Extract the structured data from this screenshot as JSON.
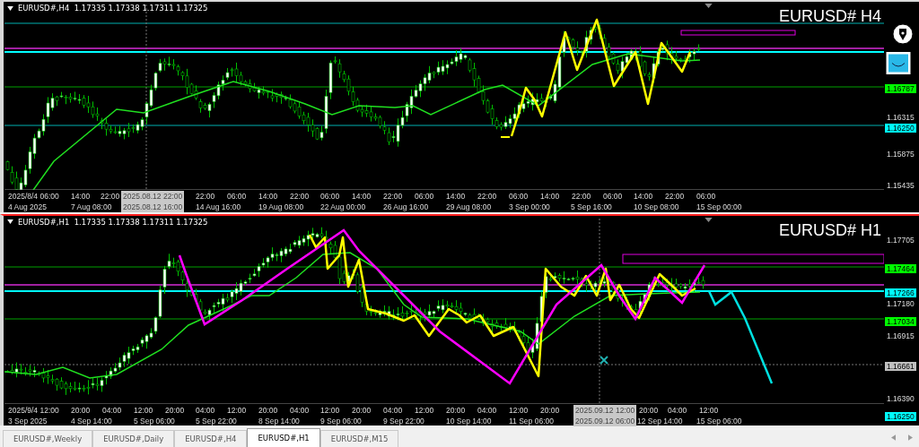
{
  "panes": [
    {
      "header": "EURUSD#,H4  1.17335 1.17338 1.17311 1.17325",
      "title": "EURUSD# H4",
      "active": false,
      "price_labels": [
        {
          "text": "1.16787",
          "kind": "badge",
          "color": "#00ff00"
        },
        {
          "text": "1.16315",
          "kind": "plain"
        },
        {
          "text": "1.16250",
          "kind": "badge",
          "color": "#00ffff"
        },
        {
          "text": "1.15875",
          "kind": "plain"
        },
        {
          "text": "1.15435",
          "kind": "plain"
        }
      ],
      "time_row_1": [
        {
          "text": "2025/8/4 06:00",
          "highlight": false
        },
        {
          "text": "14:00",
          "highlight": false
        },
        {
          "text": "22:00",
          "highlight": false
        },
        {
          "text": "2025.08.12 22:00",
          "highlight": true
        },
        {
          "text": "22:00",
          "highlight": false
        },
        {
          "text": "06:00",
          "highlight": false
        },
        {
          "text": "14:00",
          "highlight": false
        },
        {
          "text": "22:00",
          "highlight": false
        },
        {
          "text": "06:00",
          "highlight": false
        },
        {
          "text": "14:00",
          "highlight": false
        },
        {
          "text": "22:00",
          "highlight": false
        },
        {
          "text": "06:00",
          "highlight": false
        },
        {
          "text": "14:00",
          "highlight": false
        },
        {
          "text": "22:00",
          "highlight": false
        },
        {
          "text": "06:00",
          "highlight": false
        },
        {
          "text": "14:00",
          "highlight": false
        },
        {
          "text": "22:00",
          "highlight": false
        },
        {
          "text": "06:00",
          "highlight": false
        },
        {
          "text": "14:00",
          "highlight": false
        },
        {
          "text": "22:00",
          "highlight": false
        },
        {
          "text": "06:00",
          "highlight": false
        }
      ],
      "time_row_2": [
        {
          "text": "4 Aug 2025",
          "highlight": false
        },
        {
          "text": "7 Aug 08:00",
          "highlight": false
        },
        {
          "text": "2025.08.12 16:00",
          "highlight": true
        },
        {
          "text": "14 Aug 16:00",
          "highlight": false
        },
        {
          "text": "19 Aug 08:00",
          "highlight": false
        },
        {
          "text": "22 Aug 00:00",
          "highlight": false
        },
        {
          "text": "26 Aug 16:00",
          "highlight": false
        },
        {
          "text": "29 Aug 08:00",
          "highlight": false
        },
        {
          "text": "3 Sep 00:00",
          "highlight": false
        },
        {
          "text": "5 Sep 16:00",
          "highlight": false
        },
        {
          "text": "10 Sep 08:00",
          "highlight": false
        },
        {
          "text": "15 Sep 00:00",
          "highlight": false
        }
      ]
    },
    {
      "header": "EURUSD#,H1  1.17335 1.17338 1.17311 1.17325",
      "title": "EURUSD# H1",
      "active": true,
      "price_labels": [
        {
          "text": "1.17705",
          "kind": "plain"
        },
        {
          "text": "1.17464",
          "kind": "badge",
          "color": "#00ff00"
        },
        {
          "text": "1.17266",
          "kind": "badge",
          "color": "#00ffff"
        },
        {
          "text": "1.17180",
          "kind": "plain"
        },
        {
          "text": "1.17034",
          "kind": "badge",
          "color": "#00ff00"
        },
        {
          "text": "1.16915",
          "kind": "plain"
        },
        {
          "text": "1.16661",
          "kind": "badge",
          "color": "#c0c0c0"
        },
        {
          "text": "1.16390",
          "kind": "plain"
        },
        {
          "text": "1.16250",
          "kind": "badge",
          "color": "#00ffff"
        }
      ],
      "time_row_1": [
        {
          "text": "2025/9/4 12:00",
          "highlight": false
        },
        {
          "text": "20:00",
          "highlight": false
        },
        {
          "text": "04:00",
          "highlight": false
        },
        {
          "text": "12:00",
          "highlight": false
        },
        {
          "text": "20:00",
          "highlight": false
        },
        {
          "text": "04:00",
          "highlight": false
        },
        {
          "text": "12:00",
          "highlight": false
        },
        {
          "text": "20:00",
          "highlight": false
        },
        {
          "text": "04:00",
          "highlight": false
        },
        {
          "text": "12:00",
          "highlight": false
        },
        {
          "text": "20:00",
          "highlight": false
        },
        {
          "text": "04:00",
          "highlight": false
        },
        {
          "text": "12:00",
          "highlight": false
        },
        {
          "text": "20:00",
          "highlight": false
        },
        {
          "text": "04:00",
          "highlight": false
        },
        {
          "text": "12:00",
          "highlight": false
        },
        {
          "text": "20:00",
          "highlight": false
        },
        {
          "text": "2025.09.12 12:00",
          "highlight": true
        },
        {
          "text": "20:00",
          "highlight": false
        },
        {
          "text": "04:00",
          "highlight": false
        },
        {
          "text": "12:00",
          "highlight": false
        }
      ],
      "time_row_2": [
        {
          "text": "3 Sep 2025",
          "highlight": false
        },
        {
          "text": "4 Sep 14:00",
          "highlight": false
        },
        {
          "text": "5 Sep 06:00",
          "highlight": false
        },
        {
          "text": "5 Sep 22:00",
          "highlight": false
        },
        {
          "text": "8 Sep 14:00",
          "highlight": false
        },
        {
          "text": "9 Sep 06:00",
          "highlight": false
        },
        {
          "text": "9 Sep 22:00",
          "highlight": false
        },
        {
          "text": "10 Sep 14:00",
          "highlight": false
        },
        {
          "text": "11 Sep 06:00",
          "highlight": false
        },
        {
          "text": "2025.09.12 06:00",
          "highlight": true
        },
        {
          "text": "12 Sep 14:00",
          "highlight": false
        },
        {
          "text": "15 Sep 06:00",
          "highlight": false
        }
      ]
    }
  ],
  "tabs": [
    {
      "label": "EURUSD#,Weekly",
      "selected": false
    },
    {
      "label": "EURUSD#,Daily",
      "selected": false
    },
    {
      "label": "EURUSD#,H4",
      "selected": false
    },
    {
      "label": "EURUSD#,H1",
      "selected": true
    },
    {
      "label": "EURUSD#,M15",
      "selected": false
    }
  ]
}
